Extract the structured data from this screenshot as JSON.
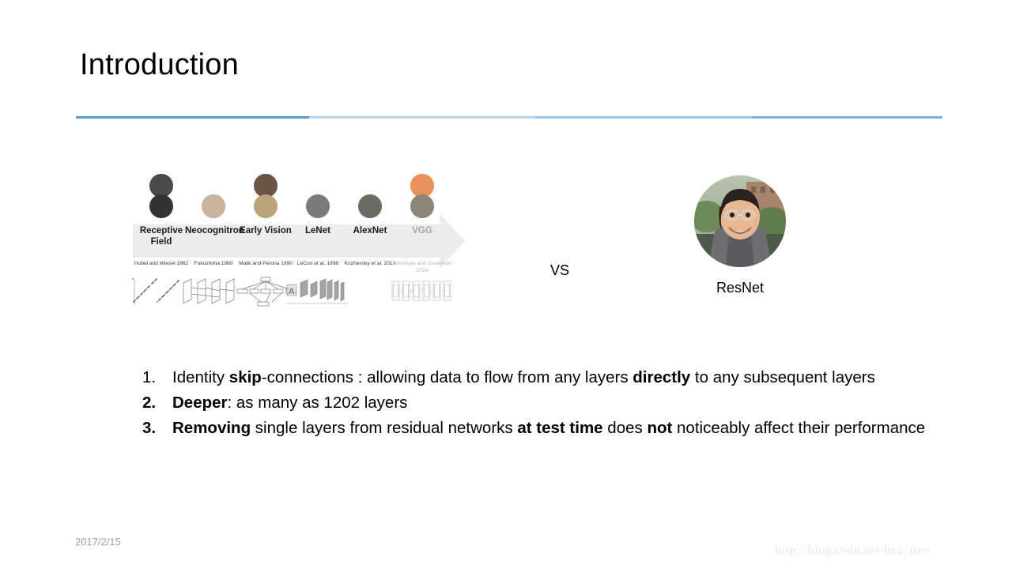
{
  "slide": {
    "title": "Introduction",
    "divider_colors": [
      "#5b9bd5",
      "#b8d6ee",
      "#9cc6e6",
      "#79b0dd"
    ]
  },
  "timeline_figure": {
    "name": "cnn-history-timeline",
    "band_color": "#ececec",
    "columns": [
      {
        "label": "Receptive Field",
        "caption": "Hubel and Wiesel 1962",
        "dim": false,
        "portraits": 2,
        "portrait_colors": [
          "#4a4a4a",
          "#333333"
        ],
        "sketch": "scatter-plot-sketch"
      },
      {
        "label": "Neocognitron",
        "caption": "Fukushima 1980",
        "dim": false,
        "portraits": 1,
        "portrait_colors": [
          "#c9b39c"
        ],
        "sketch": "layered-planes-sketch"
      },
      {
        "label": "Early Vision",
        "caption": "Malik and Perona 1990",
        "dim": false,
        "portraits": 2,
        "portrait_colors": [
          "#6b5346",
          "#b9a478"
        ],
        "sketch": "tree-graph-sketch"
      },
      {
        "label": "LeNet",
        "caption": "LeCun et al. 1998",
        "dim": false,
        "portraits": 1,
        "portrait_colors": [
          "#7d7b78"
        ],
        "sketch": "lenet-architecture-sketch"
      },
      {
        "label": "AlexNet",
        "caption": "Krizhevsky et al. 2012",
        "dim": false,
        "portraits": 1,
        "portrait_colors": [
          "#6f6a64"
        ],
        "sketch": ""
      },
      {
        "label": "VGG",
        "caption": "Simonyan and Zisserman 2014",
        "dim": true,
        "portraits": 2,
        "portrait_colors": [
          "#e8915a",
          "#8e8578"
        ],
        "sketch": "vgg-architecture-sketch"
      }
    ]
  },
  "comparison": {
    "vs_label": "VS",
    "resnet_label": "ResNet",
    "resnet_photo": "kaiming-he-portrait-photo"
  },
  "bullets": [
    {
      "number": "1.",
      "number_bold": false,
      "parts": [
        {
          "text": "Identity ",
          "bold": false
        },
        {
          "text": "skip",
          "bold": true
        },
        {
          "text": "-connections : allowing data to flow from any layers ",
          "bold": false
        },
        {
          "text": "directly",
          "bold": true
        },
        {
          "text": " to any subsequent layers",
          "bold": false
        }
      ]
    },
    {
      "number": "2.",
      "number_bold": true,
      "parts": [
        {
          "text": "Deeper",
          "bold": true
        },
        {
          "text": ": as many as 1202 layers",
          "bold": false
        }
      ]
    },
    {
      "number": "3.",
      "number_bold": true,
      "parts": [
        {
          "text": "Removing",
          "bold": true
        },
        {
          "text": " single layers from residual networks ",
          "bold": false
        },
        {
          "text": "at test time",
          "bold": true
        },
        {
          "text": " does ",
          "bold": false
        },
        {
          "text": "not",
          "bold": true
        },
        {
          "text": " noticeably affect their performance",
          "bold": false
        }
      ]
    }
  ],
  "footer": {
    "date": "2017/2/15",
    "watermark": "http://blog.csdn.net/bea_tree"
  }
}
